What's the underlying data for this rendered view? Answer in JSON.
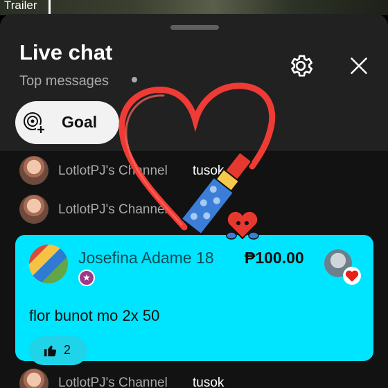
{
  "video": {
    "label": "Trailer"
  },
  "chat": {
    "title": "Live chat",
    "mode": "Top messages",
    "settings_icon": "gear-icon",
    "close_icon": "close-icon"
  },
  "goal": {
    "label": "Goal",
    "icon": "goal-add-icon"
  },
  "messages": [
    {
      "author": "LotlotPJ's Channel",
      "text": "tusok"
    },
    {
      "author": "LotlotPJ's Channel",
      "text": ""
    },
    {
      "author": "LotlotPJ's Channel",
      "text": "tusok"
    }
  ],
  "superchat": {
    "author": "Josefina Adame 18",
    "amount": "₱100.00",
    "message": "flor bunot mo 2x 50",
    "likes": "2",
    "badge_icon": "star-icon",
    "color": "#00e5ff"
  },
  "sticker": {
    "icon": "heart-lipstick-sticker"
  }
}
